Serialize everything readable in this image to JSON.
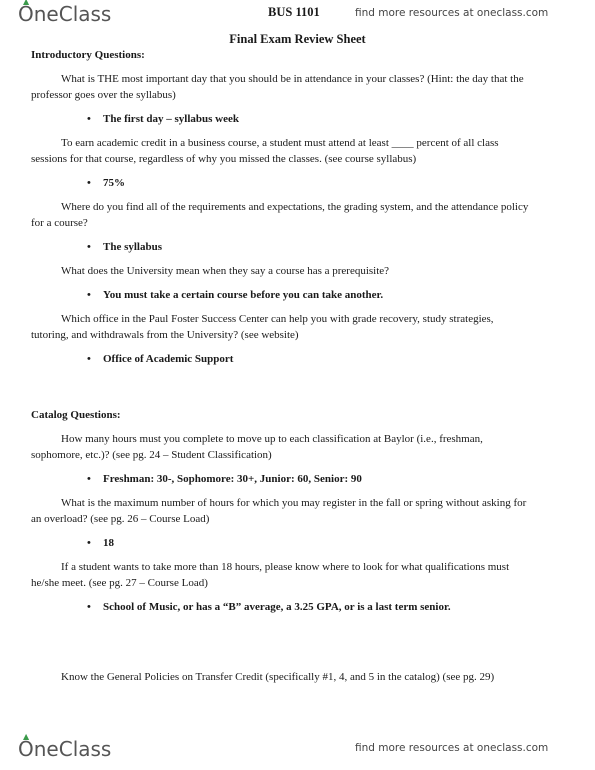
{
  "header": {
    "logo_text": "OneClass",
    "course_code": "BUS 1101",
    "promo_text": "find more resources at oneclass.com"
  },
  "document": {
    "title": "Final Exam Review Sheet",
    "sections": [
      {
        "heading": "Introductory Questions:",
        "items": [
          {
            "question": "What is THE most important day that you should be in attendance in your classes? (Hint: the day that the professor goes over the syllabus)",
            "answer": "The first day – syllabus week"
          },
          {
            "question": "To earn academic credit in a business course, a student must attend at least ____ percent of all class sessions for that course, regardless of why you missed the classes. (see course syllabus)",
            "answer": "75%"
          },
          {
            "question": "Where do you find all of the requirements and expectations, the grading system, and the attendance policy for a course?",
            "answer": "The syllabus"
          },
          {
            "question": "What does the University mean when they say a course has a prerequisite?",
            "answer": "You must take a certain course before you can take another."
          },
          {
            "question": "Which office in the Paul Foster Success Center can help you with grade recovery, study strategies, tutoring, and withdrawals from the University? (see website)",
            "answer": "Office of Academic Support"
          }
        ]
      },
      {
        "heading": "Catalog Questions:",
        "items": [
          {
            "question": "How many hours must you complete to move up to each classification at Baylor (i.e., freshman, sophomore, etc.)? (see pg. 24 – Student Classification)",
            "answer": "Freshman: 30-, Sophomore: 30+, Junior: 60, Senior: 90"
          },
          {
            "question": "What is the maximum number of hours for which you may register in the fall or spring without asking for an overload? (see pg. 26 – Course Load)",
            "answer": "18"
          },
          {
            "question": "If a student wants to take more than 18 hours, please know where to look for what qualifications must he/she meet. (see pg. 27 – Course Load)",
            "answer": "School of Music, or has a “B” average, a 3.25 GPA, or is a last term senior."
          }
        ],
        "note": "Know the General Policies on Transfer Credit (specifically #1, 4, and 5 in the catalog) (see pg. 29)"
      }
    ]
  },
  "footer": {
    "logo_text": "OneClass",
    "promo_text": "find more resources at oneclass.com"
  }
}
